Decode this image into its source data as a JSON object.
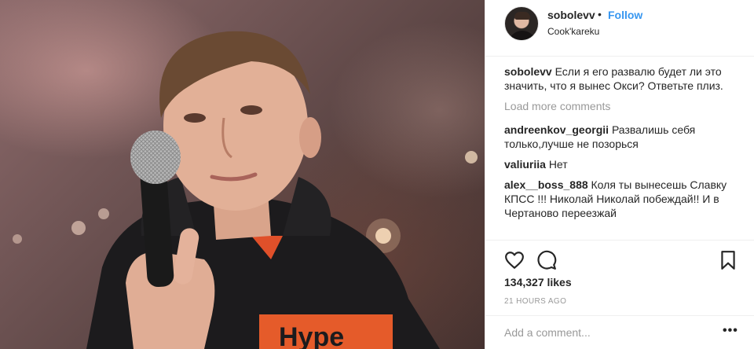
{
  "post": {
    "username": "sobolevv",
    "separator": "•",
    "follow_label": "Follow",
    "location": "Cook'kareku",
    "photo_overlay_text": "Hype"
  },
  "caption": {
    "user": "sobolevv",
    "text": "Если я его развалю будет ли это значить, что я вынес Окси? Ответьте плиз."
  },
  "load_more_label": "Load more comments",
  "comments": [
    {
      "user": "andreenkov_georgii",
      "text": "Развалишь себя только,лучше не позорься"
    },
    {
      "user": "valiuriia",
      "text": "Нет"
    },
    {
      "user": "alex__boss_888",
      "text": "Коля ты вынесешь Славку КПСС !!! Николай Николай побеждай!! И в Чертаново переезжай"
    }
  ],
  "icons": {
    "like": "heart-icon",
    "comment": "comment-bubble-icon",
    "save": "bookmark-icon",
    "options": "more-options-icon"
  },
  "likes": "134,327 likes",
  "timestamp": "21 HOURS AGO",
  "add_comment": {
    "placeholder": "Add a comment...",
    "value": ""
  },
  "more_label": "•••"
}
